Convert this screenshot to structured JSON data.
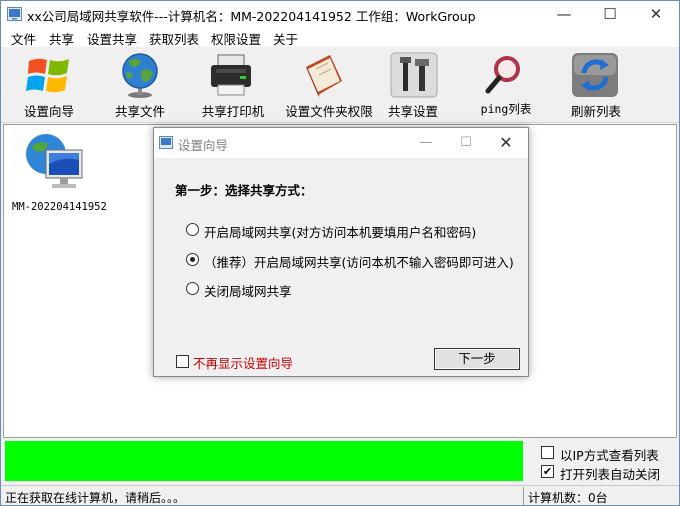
{
  "window": {
    "title": "xx公司局域网共享软件---计算机名：MM-202204141952   工作组：WorkGroup",
    "controls": {
      "minimize": "—",
      "maximize": "☐",
      "close": "✕"
    }
  },
  "menu": {
    "items": [
      "文件",
      "共享",
      "设置共享",
      "获取列表",
      "权限设置",
      "关于"
    ]
  },
  "toolbar": {
    "items": [
      {
        "label": "设置向导",
        "icon": "windows-logo-icon"
      },
      {
        "label": "共享文件",
        "icon": "globe-icon"
      },
      {
        "label": "共享打印机",
        "icon": "printer-icon"
      },
      {
        "label": "设置文件夹权限",
        "icon": "book-icon"
      },
      {
        "label": "共享设置",
        "icon": "tools-icon"
      },
      {
        "label": "ping列表",
        "icon": "magnifier-icon"
      },
      {
        "label": "刷新列表",
        "icon": "refresh-icon"
      }
    ]
  },
  "computers": [
    {
      "name": "MM-202204141952",
      "icon": "network-computer-icon"
    }
  ],
  "dialog": {
    "title": "设置向导",
    "controls": {
      "minimize": "—",
      "maximize": "☐",
      "close": "✕"
    },
    "step_heading": "第一步：选择共享方式：",
    "options": [
      {
        "label": "开启局域网共享(对方访问本机要填用户名和密码)",
        "checked": false
      },
      {
        "label": "（推荐）开启局域网共享(访问本机不输入密码即可进入)",
        "checked": true
      },
      {
        "label": "关闭局域网共享",
        "checked": false
      }
    ],
    "dont_show_label": "不再显示设置向导",
    "dont_show_checked": false,
    "next_button": "下一步"
  },
  "progress": {
    "value": 1.0,
    "color": "#00ff00"
  },
  "list_options": [
    {
      "label": "以IP方式查看列表",
      "checked": false
    },
    {
      "label": "打开列表自动关闭",
      "checked": true
    }
  ],
  "status": {
    "message": "正在获取在线计算机，请稍后。。。",
    "count": "计算机数：0台"
  }
}
